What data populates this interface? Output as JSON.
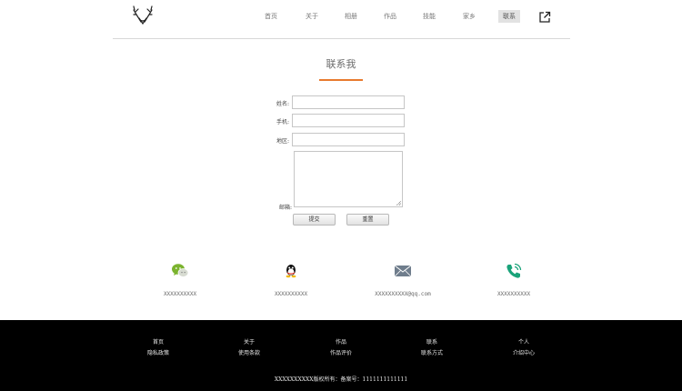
{
  "nav": {
    "items": [
      {
        "label": "首页",
        "active": false
      },
      {
        "label": "关于",
        "active": false
      },
      {
        "label": "相册",
        "active": false
      },
      {
        "label": "作品",
        "active": false
      },
      {
        "label": "技能",
        "active": false
      },
      {
        "label": "家乡",
        "active": false
      },
      {
        "label": "联系",
        "active": true
      }
    ],
    "logo_icon": "deer-antler-icon",
    "external_icon": "external-link-icon"
  },
  "page": {
    "title": "联系我",
    "accent_color": "#e87a2e"
  },
  "form": {
    "name_label": "姓名:",
    "phone_label": "手机:",
    "region_label": "地区:",
    "email_label": "邮箱:",
    "name_value": "",
    "phone_value": "",
    "region_value": "",
    "email_value": "",
    "submit_label": "提交",
    "reset_label": "重置"
  },
  "contacts": [
    {
      "icon": "wechat-icon",
      "text": "XXXXXXXXXX",
      "color": "#7bb32e"
    },
    {
      "icon": "qq-icon",
      "text": "XXXXXXXXXX",
      "color": "#111111"
    },
    {
      "icon": "mail-icon",
      "text": "XXXXXXXXXX@qq.com",
      "color": "#6f7d8c"
    },
    {
      "icon": "phone-icon",
      "text": "XXXXXXXXXX",
      "color": "#1aa37a"
    }
  ],
  "footer": {
    "columns": [
      {
        "top": "首页",
        "bottom": "隐私政策"
      },
      {
        "top": "关于",
        "bottom": "使用条款"
      },
      {
        "top": "作品",
        "bottom": "作品评价"
      },
      {
        "top": "联系",
        "bottom": "联系方式"
      },
      {
        "top": "个人",
        "bottom": "介绍中心"
      }
    ],
    "copyright": "XXXXXXXXXX版权所有：备案号：1111111111111"
  }
}
